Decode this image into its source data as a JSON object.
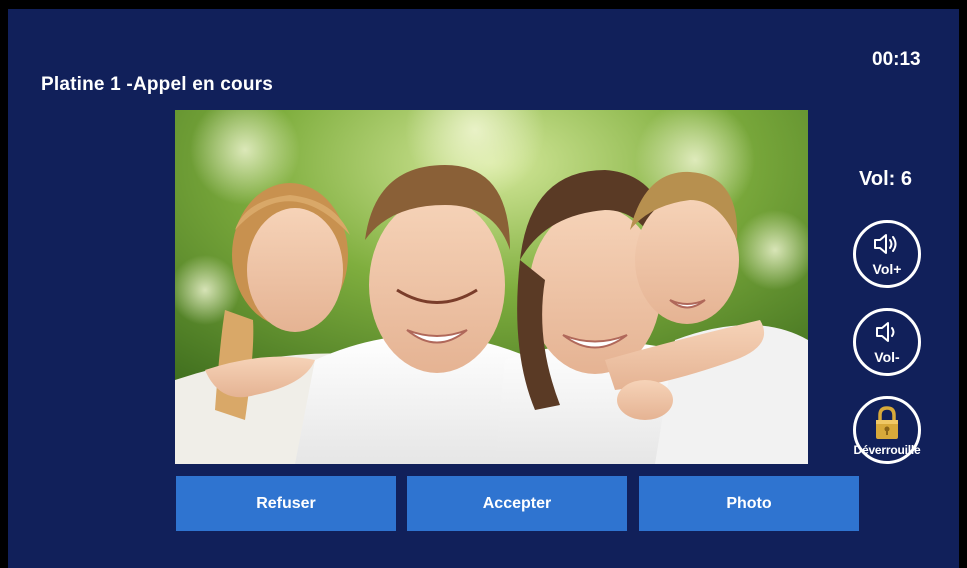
{
  "call": {
    "title": "Platine 1 -Appel en cours",
    "timer": "00:13"
  },
  "volume": {
    "readout": "Vol: 6",
    "up_label": "Vol+",
    "up_icon": "speaker-loud-icon",
    "down_label": "Vol-",
    "down_icon": "speaker-quiet-icon"
  },
  "unlock": {
    "label": "Déverrouille",
    "icon": "padlock-icon",
    "icon_color": "#d8a93a"
  },
  "actions": {
    "refuse_label": "Refuser",
    "accept_label": "Accepter",
    "photo_label": "Photo"
  },
  "video": {
    "subject": "family-video-feed"
  },
  "theme": {
    "background": "#11205a",
    "button": "#2f74d0",
    "text": "#ffffff"
  }
}
